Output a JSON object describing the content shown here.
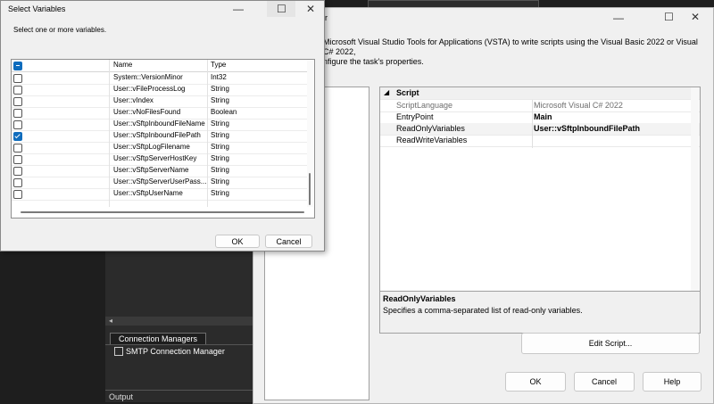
{
  "select_variables": {
    "title": "Select Variables",
    "instruction": "Select one or more variables.",
    "columns": {
      "name": "Name",
      "type": "Type"
    },
    "rows": [
      {
        "name": "System::VersionMinor",
        "type": "Int32",
        "checked": false
      },
      {
        "name": "User::vFileProcessLog",
        "type": "String",
        "checked": false
      },
      {
        "name": "User::vIndex",
        "type": "String",
        "checked": false
      },
      {
        "name": "User::vNoFilesFound",
        "type": "Boolean",
        "checked": false
      },
      {
        "name": "User::vSftpInboundFileName",
        "type": "String",
        "checked": false
      },
      {
        "name": "User::vSftpInboundFilePath",
        "type": "String",
        "checked": true
      },
      {
        "name": "User::vSftpLogFilename",
        "type": "String",
        "checked": false
      },
      {
        "name": "User::vSftpServerHostKey",
        "type": "String",
        "checked": false
      },
      {
        "name": "User::vSftpServerName",
        "type": "String",
        "checked": false
      },
      {
        "name": "User::vSftpServerUserPass...",
        "type": "String",
        "checked": false
      },
      {
        "name": "User::vSftpUserName",
        "type": "String",
        "checked": false
      }
    ],
    "ok_label": "OK",
    "cancel_label": "Cancel",
    "scroll_fraction": 1.0
  },
  "editor": {
    "title_fragment": "r",
    "description_line1": "Microsoft Visual Studio Tools for Applications (VSTA) to write scripts using the Visual Basic 2022 or Visual C# 2022,",
    "description_line2": "nfigure the task's properties.",
    "section": "Script",
    "properties": [
      {
        "key": "ScriptLanguage",
        "value": "Microsoft Visual C# 2022",
        "disabled": true,
        "bold": false
      },
      {
        "key": "EntryPoint",
        "value": "Main",
        "disabled": false,
        "bold": true
      },
      {
        "key": "ReadOnlyVariables",
        "value": "User::vSftpInboundFilePath",
        "disabled": false,
        "bold": true
      },
      {
        "key": "ReadWriteVariables",
        "value": "",
        "disabled": false,
        "bold": false
      }
    ],
    "help_title": "ReadOnlyVariables",
    "help_text": "Specifies a comma-separated list of read-only variables.",
    "edit_script_label": "Edit Script...",
    "ok_label": "OK",
    "cancel_label": "Cancel",
    "help_label": "Help"
  },
  "background": {
    "connection_managers_tab": "Connection Managers",
    "connection_item": "SMTP Connection Manager",
    "output_label": "Output"
  },
  "colors": {
    "accent": "#0f6cbd",
    "dark_bg": "#1e1e1e"
  }
}
